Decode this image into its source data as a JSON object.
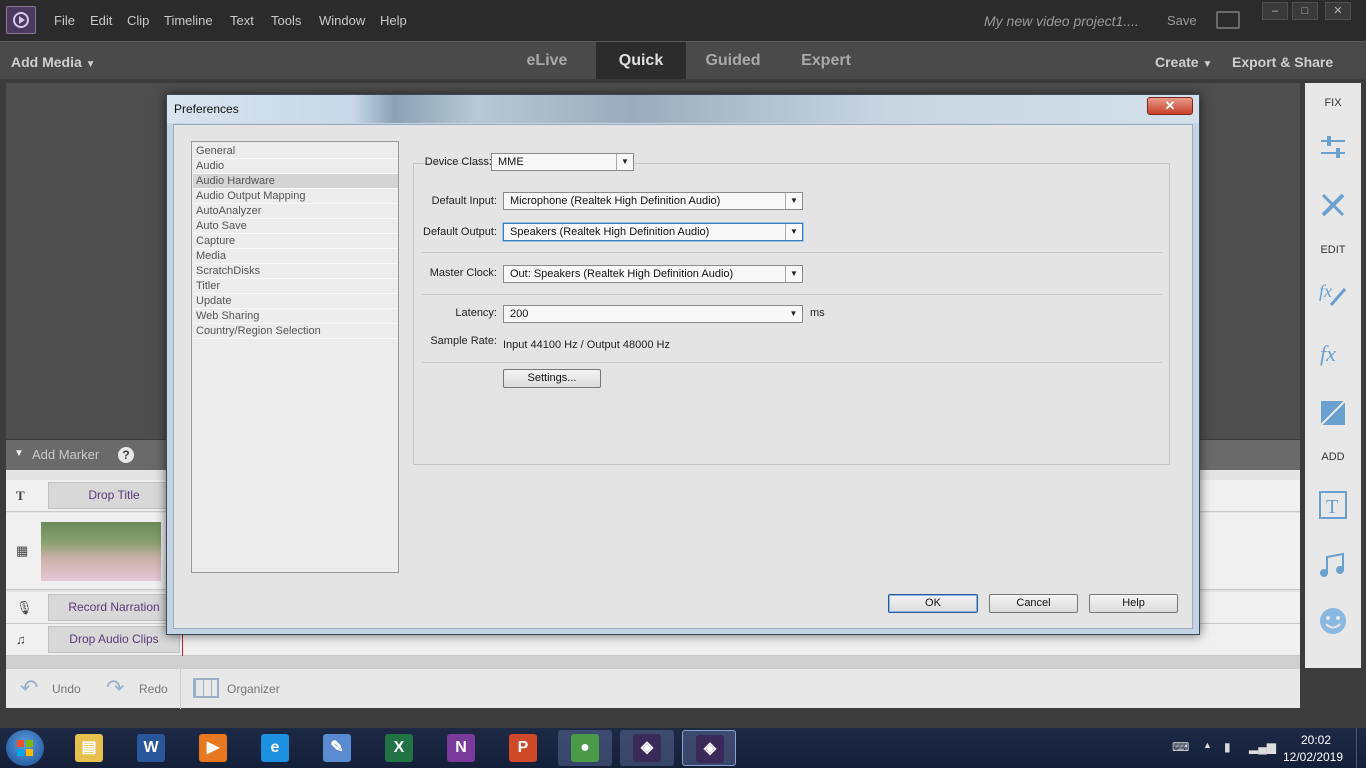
{
  "app": {
    "menus": [
      "File",
      "Edit",
      "Clip",
      "Timeline",
      "Text",
      "Tools",
      "Window",
      "Help"
    ],
    "project_name": "My new video project1....",
    "save_label": "Save",
    "window_controls": [
      "–",
      "□",
      "✕"
    ]
  },
  "workspace": {
    "add_media": "Add Media",
    "modes": [
      "eLive",
      "Quick",
      "Guided",
      "Expert"
    ],
    "active_mode": "Quick",
    "create": "Create",
    "export_share": "Export & Share"
  },
  "right_panel": {
    "fix_label": "FIX",
    "edit_label": "EDIT",
    "add_label": "ADD",
    "icons": [
      "adjustments-icon",
      "tools-icon",
      "fx-edit-icon",
      "fx-icon",
      "color-icon",
      "title-icon",
      "music-icon",
      "graphics-icon"
    ]
  },
  "timeline": {
    "add_marker": "Add Marker",
    "help": "?",
    "tracks": {
      "title": "Drop Title",
      "narration": "Record Narration",
      "audio": "Drop Audio Clips"
    }
  },
  "bottom_bar": {
    "undo": "Undo",
    "redo": "Redo",
    "organizer": "Organizer"
  },
  "dialog": {
    "title": "Preferences",
    "close": "✕",
    "categories": [
      {
        "label": "General",
        "selected": false
      },
      {
        "label": "Audio",
        "selected": false
      },
      {
        "label": "Audio Hardware",
        "selected": true
      },
      {
        "label": "Audio Output Mapping",
        "selected": false
      },
      {
        "label": "AutoAnalyzer",
        "selected": false
      },
      {
        "label": "Auto Save",
        "selected": false
      },
      {
        "label": "Capture",
        "selected": false
      },
      {
        "label": "Media",
        "selected": false
      },
      {
        "label": "ScratchDisks",
        "selected": false
      },
      {
        "label": "Titler",
        "selected": false
      },
      {
        "label": "Update",
        "selected": false
      },
      {
        "label": "Web Sharing",
        "selected": false
      },
      {
        "label": "Country/Region Selection",
        "selected": false
      }
    ],
    "device_class": {
      "label": "Device Class:",
      "value": "MME"
    },
    "default_input": {
      "label": "Default Input:",
      "value": "Microphone (Realtek High Definition Audio)"
    },
    "default_output": {
      "label": "Default Output:",
      "value": "Speakers (Realtek High Definition Audio)"
    },
    "master_clock": {
      "label": "Master Clock:",
      "value": "Out: Speakers (Realtek High Definition Audio)"
    },
    "latency": {
      "label": "Latency:",
      "value": "200",
      "unit": "ms"
    },
    "sample_rate": {
      "label": "Sample Rate:",
      "value": "Input 44100 Hz / Output 48000 Hz"
    },
    "settings_button": "Settings...",
    "ok": "OK",
    "cancel": "Cancel",
    "help": "Help"
  },
  "taskbar": {
    "apps": [
      "file-explorer",
      "word",
      "media-player",
      "internet-explorer",
      "paint",
      "excel",
      "onenote",
      "powerpoint",
      "chrome",
      "premiere-elements-organizer",
      "premiere-elements"
    ],
    "time": "20:02",
    "date": "12/02/2019"
  },
  "colors": {
    "accent": "#5a3a7a",
    "dialog_frame": "#c4d4e4",
    "close_red": "#c8402a"
  }
}
